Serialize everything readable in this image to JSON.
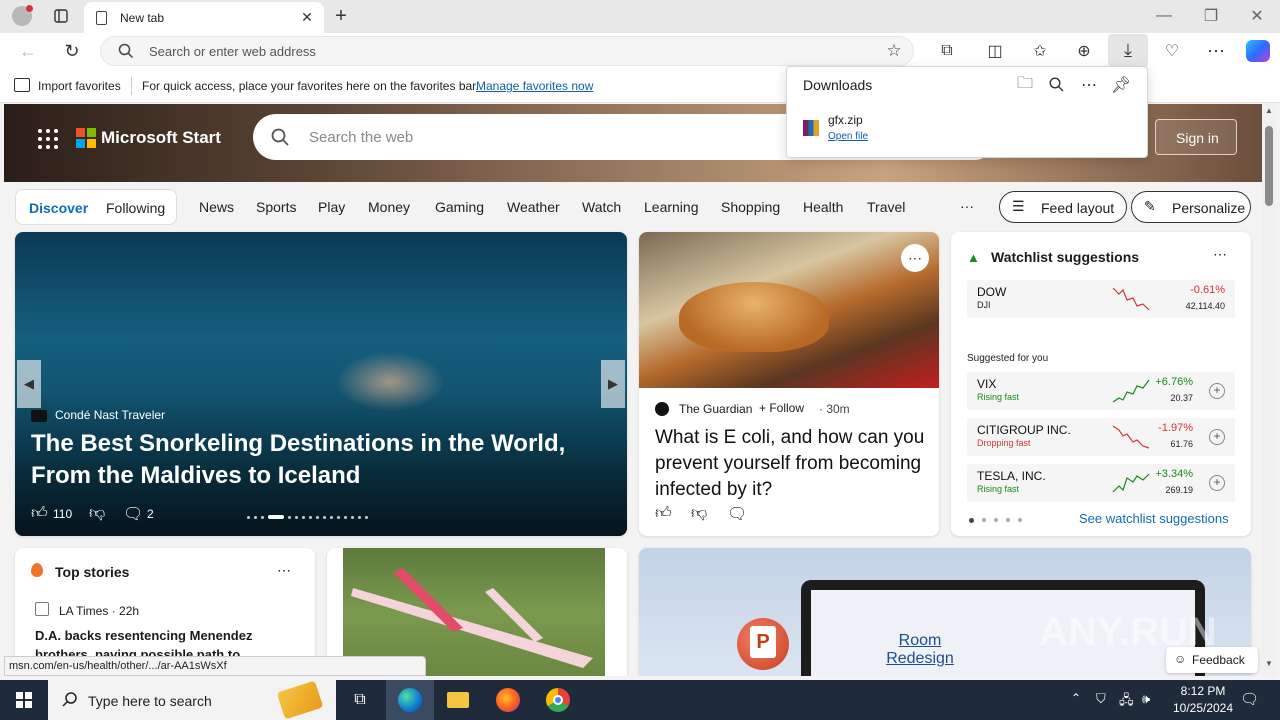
{
  "browser": {
    "tab_title": "New tab",
    "address_placeholder": "Search or enter web address",
    "window_controls": [
      "minimize-icon",
      "restore-icon",
      "close-icon"
    ]
  },
  "favorites_bar": {
    "import_label": "Import favorites",
    "hint": "For quick access, place your favorites here on the favorites bar.",
    "manage_link": "Manage favorites now"
  },
  "downloads": {
    "title": "Downloads",
    "file_name": "gfx.zip",
    "open_link": "Open file"
  },
  "msn": {
    "brand": "Microsoft Start",
    "search_placeholder": "Search the web",
    "sign_in": "Sign in",
    "pill_tabs": [
      "Discover",
      "Following"
    ],
    "nav": [
      "News",
      "Sports",
      "Play",
      "Money",
      "Gaming",
      "Weather",
      "Watch",
      "Learning",
      "Shopping",
      "Health",
      "Travel"
    ],
    "more": "···",
    "feed_layout": "Feed layout",
    "personalize": "Personalize"
  },
  "hero_card": {
    "source": "Condé Nast Traveler",
    "headline": "The Best Snorkeling Destinations in the World, From the Maldives to Iceland",
    "likes": "110",
    "comments": "2"
  },
  "news_card": {
    "source": "The Guardian",
    "follow": "Follow",
    "age": "· 30m",
    "headline": "What is E coli, and how can you prevent yourself from becoming infected by it?"
  },
  "watchlist": {
    "title": "Watchlist suggestions",
    "dow": {
      "name": "DOW",
      "sub": "DJI",
      "change": "-0.61%",
      "value": "42,114.40"
    },
    "suggested_label": "Suggested for you",
    "stocks": [
      {
        "name": "VIX",
        "status": "Rising fast",
        "change": "+6.76%",
        "value": "20.37",
        "dir": "up"
      },
      {
        "name": "CITIGROUP INC.",
        "status": "Dropping fast",
        "change": "-1.97%",
        "value": "61.76",
        "dir": "down"
      },
      {
        "name": "TESLA, INC.",
        "status": "Rising fast",
        "change": "+3.34%",
        "value": "269.19",
        "dir": "up"
      }
    ],
    "see_link": "See watchlist suggestions"
  },
  "top_stories": {
    "title": "Top stories",
    "source": "LA Times · 22h",
    "headline": "D.A. backs resentencing Menendez brothers, paving possible path to"
  },
  "promo": {
    "room_title": "Room Redesign",
    "feedback": "Feedback",
    "watermark": "ANY.RUN"
  },
  "status_url": "msn.com/en-us/health/other/.../ar-AA1sWsXf",
  "taskbar": {
    "search_placeholder": "Type here to search",
    "time": "8:12 PM",
    "date": "10/25/2024"
  },
  "colors": {
    "accent": "#0f6cbd",
    "up": "#1a8a1a",
    "down": "#d13438",
    "taskbar": "#1f2a3a"
  }
}
